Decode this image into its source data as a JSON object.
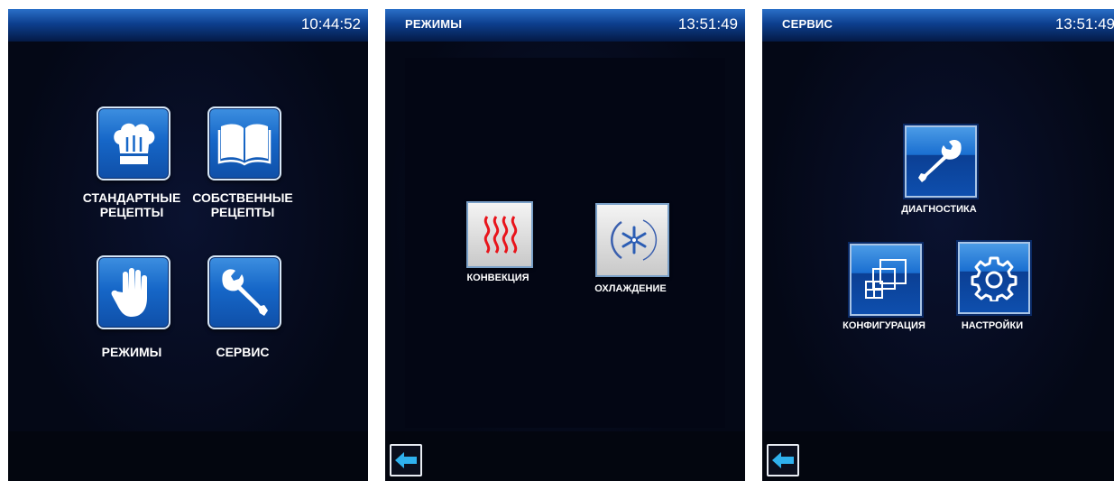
{
  "screen1": {
    "clock": "10:44:52",
    "tiles": [
      {
        "label_line1": "СТАНДАРТНЫЕ",
        "label_line2": "РЕЦЕПТЫ",
        "icon": "chef-hat-icon"
      },
      {
        "label_line1": "СОБСТВЕННЫЕ",
        "label_line2": "РЕЦЕПТЫ",
        "icon": "book-icon"
      },
      {
        "label_line1": "РЕЖИМЫ",
        "icon": "hand-icon"
      },
      {
        "label_line1": "СЕРВИС",
        "icon": "wrench-icon"
      }
    ]
  },
  "screen2": {
    "title": "РЕЖИМЫ",
    "clock": "13:51:49",
    "tiles": [
      {
        "label": "КОНВЕКЦИЯ",
        "icon": "heat-waves-icon"
      },
      {
        "label": "ОХЛАЖДЕНИЕ",
        "icon": "snowflake-icon"
      }
    ],
    "back_icon": "back-arrow-icon"
  },
  "screen3": {
    "title": "СЕРВИС",
    "clock": "13:51:49",
    "tiles": [
      {
        "label": "ДИАГНОСТИКА",
        "icon": "wrench-icon"
      },
      {
        "label": "КОНФИГУРАЦИЯ",
        "icon": "layers-icon"
      },
      {
        "label": "НАСТРОЙКИ",
        "icon": "gear-icon"
      }
    ],
    "back_icon": "back-arrow-icon"
  },
  "colors": {
    "background": "#050a1c",
    "tile_blue": "#1667c8",
    "accent_arrow": "#2fb1ee",
    "heat_red": "#e8141b"
  }
}
